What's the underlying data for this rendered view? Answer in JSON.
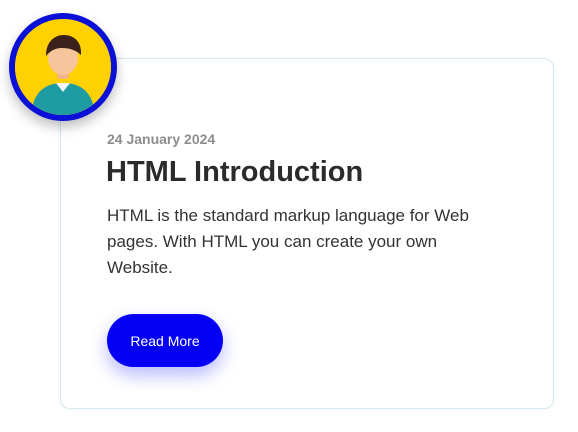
{
  "card": {
    "date": "24 January 2024",
    "title": "HTML Introduction",
    "description": "HTML is the standard markup language for Web pages. With HTML you can create your own Website.",
    "button_label": "Read More"
  },
  "avatar": {
    "icon": "user-avatar-icon"
  },
  "colors": {
    "button_background": "#0500f5",
    "avatar_border": "#0a10d6",
    "avatar_background": "#ffd100",
    "card_border": "#d6e8f0"
  }
}
